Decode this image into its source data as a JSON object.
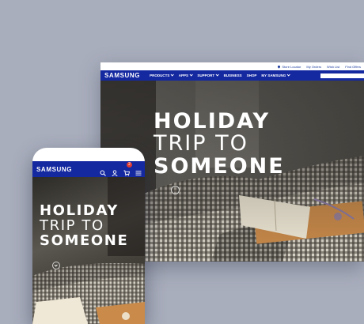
{
  "desktop": {
    "utility": {
      "store_locator": "Store Locator",
      "my_orders": "My Orders",
      "wish_list": "Wish List",
      "find_offers": "Find Offers"
    },
    "nav": {
      "logo": "SAMSUNG",
      "menu": [
        {
          "label": "PRODUCTS",
          "dropdown": true
        },
        {
          "label": "APPS",
          "dropdown": true
        },
        {
          "label": "SUPPORT",
          "dropdown": true
        },
        {
          "label": "BUSINESS",
          "dropdown": false
        },
        {
          "label": "SHOP",
          "dropdown": false
        },
        {
          "label": "MY SAMSUNG",
          "dropdown": true
        }
      ]
    },
    "hero": {
      "line1": "HOLIDAY",
      "line2": "TRIP TO",
      "line3": "SOMEONE"
    }
  },
  "mobile": {
    "nav": {
      "logo": "SAMSUNG",
      "cart_count": "2",
      "icons": [
        "search-icon",
        "user-icon",
        "cart-icon",
        "menu-icon"
      ]
    },
    "hero": {
      "line1": "HOLIDAY",
      "line2": "TRIP TO",
      "line3": "SOMEONE"
    }
  },
  "colors": {
    "brand": "#1428a0",
    "background": "#a9aebd",
    "badge": "#e03a2f"
  }
}
